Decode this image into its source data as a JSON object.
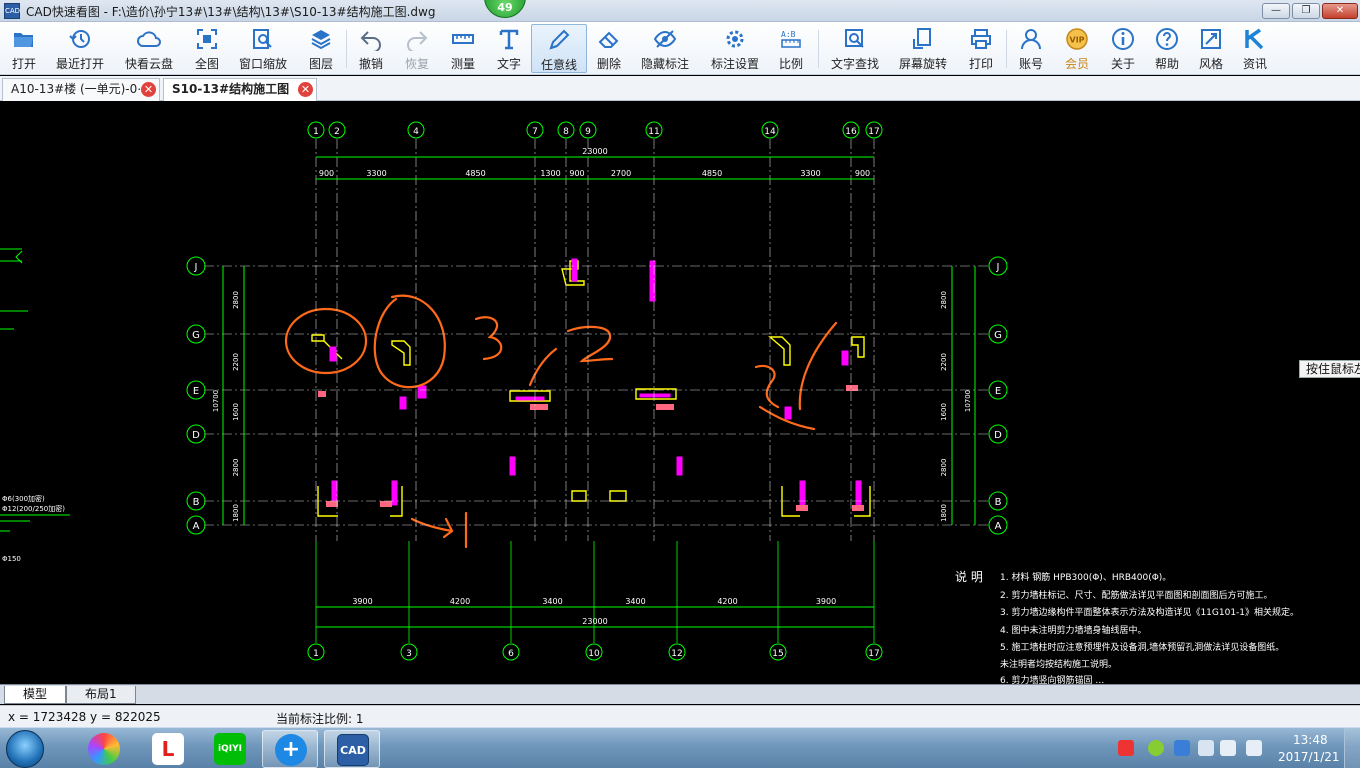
{
  "window": {
    "title": "CAD快速看图 - F:\\造价\\孙宁13#\\13#\\结构\\13#\\S10-13#结构施工图.dwg",
    "logo_text": "CAD",
    "badge": "49",
    "min": "—",
    "max": "❐",
    "close": "✕"
  },
  "toolbar": [
    {
      "id": "open",
      "label": "打开",
      "icon": "folder-icon"
    },
    {
      "id": "recent",
      "label": "最近打开",
      "icon": "history-icon"
    },
    {
      "id": "cloud",
      "label": "快看云盘",
      "icon": "cloud-icon"
    },
    {
      "id": "fit",
      "label": "全图",
      "icon": "fit-icon"
    },
    {
      "id": "zoomwin",
      "label": "窗口缩放",
      "icon": "zoom-window-icon"
    },
    {
      "id": "layers",
      "label": "图层",
      "icon": "layers-icon"
    },
    {
      "id": "undo",
      "label": "撤销",
      "icon": "undo-icon"
    },
    {
      "id": "redo",
      "label": "恢复",
      "icon": "redo-icon"
    },
    {
      "id": "measure",
      "label": "测量",
      "icon": "ruler-icon"
    },
    {
      "id": "text",
      "label": "文字",
      "icon": "text-icon"
    },
    {
      "id": "freeline",
      "label": "任意线",
      "icon": "pencil-icon"
    },
    {
      "id": "erase",
      "label": "删除",
      "icon": "eraser-icon"
    },
    {
      "id": "hide",
      "label": "隐藏标注",
      "icon": "eye-hidden-icon"
    },
    {
      "id": "dimset",
      "label": "标注设置",
      "icon": "dim-settings-icon"
    },
    {
      "id": "scale",
      "label": "比例",
      "icon": "scale-icon"
    },
    {
      "id": "findtext",
      "label": "文字查找",
      "icon": "text-search-icon"
    },
    {
      "id": "rotate",
      "label": "屏幕旋转",
      "icon": "rotate-screen-icon"
    },
    {
      "id": "print",
      "label": "打印",
      "icon": "printer-icon"
    },
    {
      "id": "account",
      "label": "账号",
      "icon": "user-icon"
    },
    {
      "id": "vip",
      "label": "会员",
      "icon": "vip-icon"
    },
    {
      "id": "about",
      "label": "关于",
      "icon": "info-icon"
    },
    {
      "id": "help",
      "label": "帮助",
      "icon": "help-icon"
    },
    {
      "id": "style",
      "label": "风格",
      "icon": "style-icon"
    },
    {
      "id": "news",
      "label": "资讯",
      "icon": "news-icon"
    }
  ],
  "tabs": [
    {
      "label": "A10-13#楼 (一单元)-0⋯",
      "close": "✕"
    },
    {
      "label": "S10-13#结构施工图",
      "close": "✕"
    }
  ],
  "drawing": {
    "axes_top": [
      "1",
      "2",
      "4",
      "7",
      "8",
      "9",
      "11",
      "14",
      "16",
      "17"
    ],
    "axes_bottom": [
      "1",
      "3",
      "6",
      "10",
      "12",
      "15",
      "17"
    ],
    "axes_rows": [
      "J",
      "G",
      "E",
      "D",
      "B",
      "A"
    ],
    "dim_total_top": "23000",
    "dims_top": [
      "900",
      "3300",
      "4850",
      "1300",
      "900",
      "2700",
      "4850",
      "3300",
      "900"
    ],
    "dims_bottom": [
      "3900",
      "4200",
      "3400",
      "3400",
      "4200",
      "3900"
    ],
    "dim_total_bottom": "23000",
    "dims_left": [
      "2800",
      "2200",
      "1600",
      "2800",
      "1800"
    ],
    "dim_overall_left": "10700",
    "notes_title": "说 明",
    "notes": [
      "1. 材料   钢筋 HPB300(Φ)、HRB400(Φ)。",
      "2. 剪力墙柱标记、尺寸、配筋做法详见平面图和剖面图后方可施工。",
      "3. 剪力墙边缘构件平面整体表示方法及构造详见《11G101-1》相关规定。",
      "4. 图中未注明剪力墙墙身轴线居中。",
      "5. 施工墙柱时应注意预埋件及设备洞,墙体预留孔洞做法详见设备图纸。",
      "   未注明者均按结构施工说明。",
      "6. 剪力墙竖向钢筋锚固 …"
    ],
    "left_fragments": [
      "Φ6(300加密)",
      "Φ12(200/250加密)",
      "Φ150"
    ],
    "hover_tip": "按住鼠标左"
  },
  "model_tabs": [
    "模型",
    "布局1"
  ],
  "status": {
    "coords": "x = 1723428 y = 822025",
    "scale": "当前标注比例: 1"
  },
  "taskbar": {
    "apps": [
      {
        "name": "photos",
        "label": ""
      },
      {
        "name": "letv",
        "label": "L"
      },
      {
        "name": "iqiyi",
        "label": "iQIYI"
      },
      {
        "name": "network",
        "label": "+"
      },
      {
        "name": "cad",
        "label": "CAD"
      }
    ],
    "time": "13:48",
    "date": "2017/1/21"
  },
  "colors": {
    "cad_green": "#00ff00",
    "cad_cyan": "#00ffff",
    "cad_yellow": "#ffff00",
    "cad_magenta": "#ff00ff",
    "annot_orange": "#ff6a1a",
    "tab_close": "#e2423d"
  }
}
